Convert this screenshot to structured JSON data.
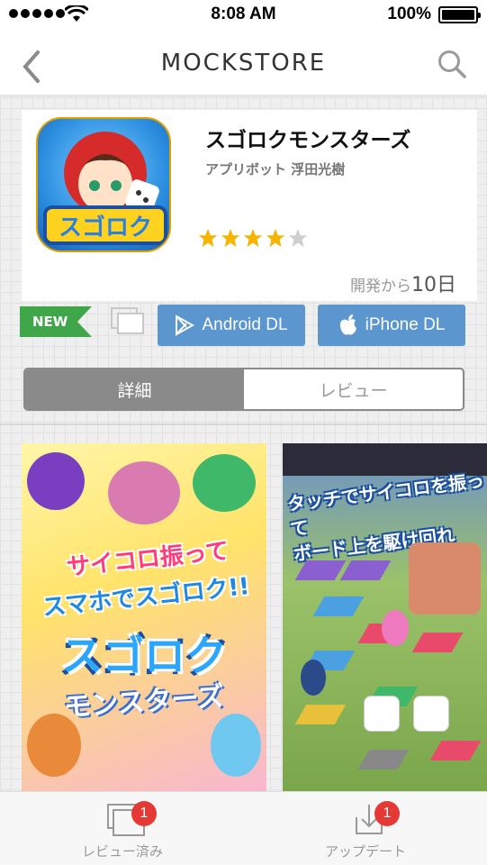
{
  "status_bar": {
    "time": "8:08 AM",
    "battery": "100%"
  },
  "nav": {
    "title": "MOCKSTORE"
  },
  "app": {
    "name": "スゴロクモンスターズ",
    "developer": "アプリボット 浮田光樹",
    "rating": 4,
    "rating_max": 5,
    "days_prefix": "開発から",
    "days_value": "10日",
    "new_label": "NEW",
    "android_label": "Android DL",
    "iphone_label": "iPhone DL",
    "icon_text": "スゴロク"
  },
  "tabs": {
    "detail": "詳細",
    "review": "レビュー"
  },
  "screenshots": {
    "shot1_line1": "サイコロ振って",
    "shot1_line2": "スマホでスゴロク!!",
    "shot1_logo": "スゴロク",
    "shot1_logo2": "モンスターズ",
    "shot2_line1": "タッチでサイコロを振って",
    "shot2_line2": "ボード上を駆け回れ"
  },
  "tabbar": {
    "reviewed_label": "レビュー済み",
    "reviewed_badge": "1",
    "update_label": "アップデート",
    "update_badge": "1"
  },
  "colors": {
    "accent_button": "#5b96cf",
    "new_badge": "#3fa64a",
    "star": "#f5b400",
    "badge": "#e53935"
  }
}
